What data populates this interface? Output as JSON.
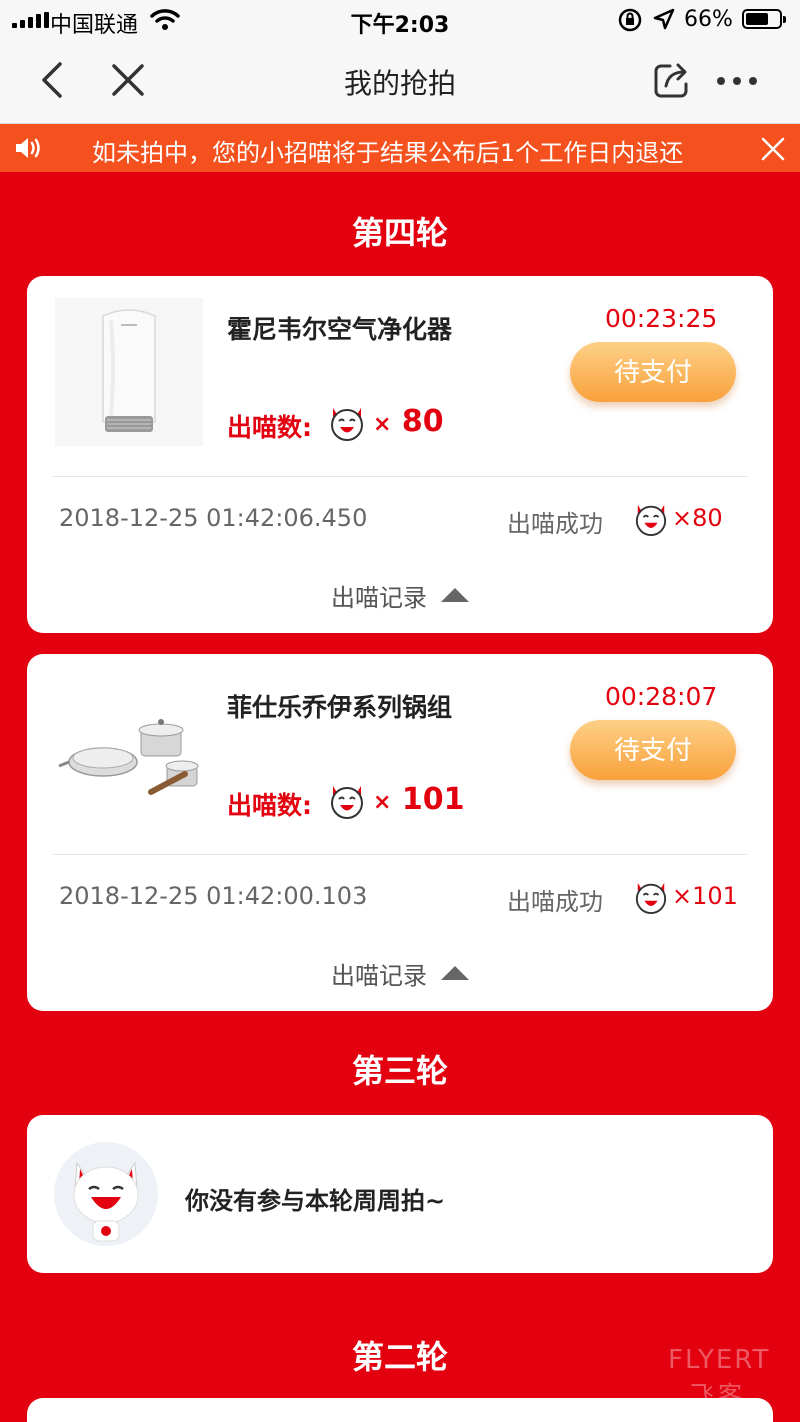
{
  "status_bar": {
    "carrier": "中国联通",
    "time": "下午2:03",
    "battery": "66%"
  },
  "nav": {
    "title": "我的抢拍",
    "icons": [
      "back-icon",
      "close-icon",
      "share-icon",
      "more-icon"
    ]
  },
  "notice": {
    "text": "如未拍中，您的小招喵将于结果公布后1个工作日内退还",
    "icons": [
      "speaker-icon",
      "close-icon"
    ]
  },
  "rounds": [
    {
      "title": "第四轮",
      "items": [
        {
          "name": "霍尼韦尔空气净化器",
          "countdown": "00:23:25",
          "button": "待支付",
          "bid_label": "出喵数:",
          "bid_mul": "×",
          "bid_num": "80",
          "timestamp": "2018-12-25 01:42:06.450",
          "status": "出喵成功",
          "status_count": "×80",
          "record_label": "出喵记录"
        },
        {
          "name": "菲仕乐乔伊系列锅组",
          "countdown": "00:28:07",
          "button": "待支付",
          "bid_label": "出喵数:",
          "bid_mul": "×",
          "bid_num": "101",
          "timestamp": "2018-12-25 01:42:00.103",
          "status": "出喵成功",
          "status_count": "×101",
          "record_label": "出喵记录"
        }
      ]
    },
    {
      "title": "第三轮",
      "message": "你没有参与本轮周周拍~"
    },
    {
      "title": "第二轮"
    }
  ],
  "watermark": {
    "line1": "FLYERT",
    "line2": "飞客"
  },
  "colors": {
    "background": "#e3000f",
    "notice": "#f4511e",
    "accent_red": "#e3000f",
    "button": "#f9a13b"
  }
}
